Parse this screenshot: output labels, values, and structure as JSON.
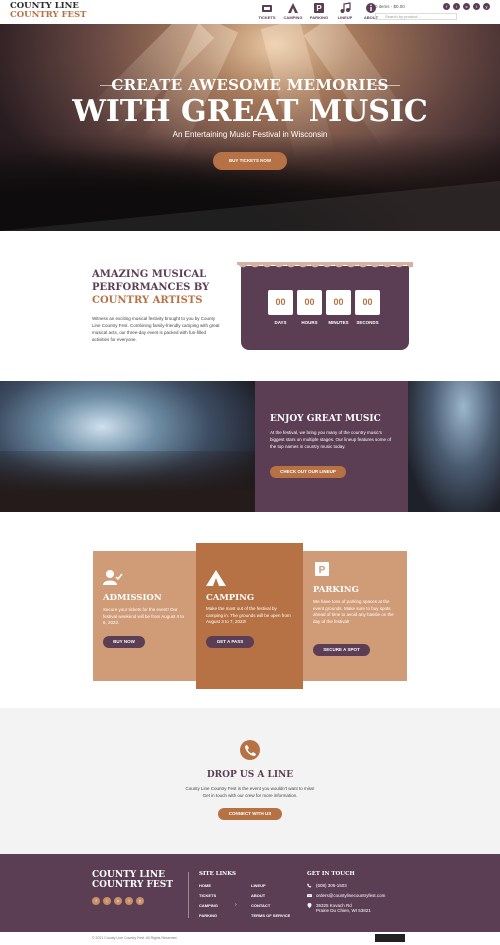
{
  "header": {
    "logo_line1": "COUNTY LINE",
    "logo_line2": "COUNTRY FEST",
    "nav": [
      {
        "label": "TICKETS",
        "icon": "ticket-icon"
      },
      {
        "label": "CAMPING",
        "icon": "tent-icon"
      },
      {
        "label": "PARKING",
        "icon": "parking-icon"
      },
      {
        "label": "LINEUP",
        "icon": "music-note-icon"
      },
      {
        "label": "ABOUT",
        "icon": "info-icon"
      }
    ],
    "cart": "0 items - $0.00",
    "search_placeholder": "Search by product...",
    "social": [
      "f",
      "i",
      "s",
      "t",
      "y"
    ]
  },
  "hero": {
    "line1": "CREATE AWESOME MEMORIES",
    "line2": "WITH GREAT MUSIC",
    "line3": "An Entertaining Music Festival in Wisconsin",
    "button": "BUY TICKETS NOW"
  },
  "amazing": {
    "title_line1": "AMAZING MUSICAL",
    "title_line2": "PERFORMANCES BY",
    "title_accent": "COUNTRY ARTISTS",
    "text": "Witness an exciting musical festivity brought to you by County Line Country Fest. Combining family-friendly camping with great musical acts, our three-day event is packed with fun-filled activities for everyone.",
    "countdown": [
      {
        "value": "00",
        "label": "DAYS"
      },
      {
        "value": "00",
        "label": "HOURS"
      },
      {
        "value": "00",
        "label": "MINUTES"
      },
      {
        "value": "00",
        "label": "SECONDS"
      }
    ]
  },
  "music": {
    "title": "ENJOY GREAT MUSIC",
    "text": "At the festival, we bring you many of the country music's biggest stars on multiple stages. Our lineup features some of the top names in country music today.",
    "button": "CHECK OUT OUR LINEUP"
  },
  "cards": [
    {
      "title": "ADMISSION",
      "text": "Secure your tickets for the event! Our festival weekend will be from August 4 to 6, 2022.",
      "button": "BUY NOW",
      "icon": "user-check-icon",
      "color": "#d09b77"
    },
    {
      "title": "CAMPING",
      "text": "Make the most out of the festival by camping in. The grounds will be open from August 3 to 7, 2022!",
      "button": "GET A PASS",
      "icon": "tent-icon",
      "color": "#b67244"
    },
    {
      "title": "PARKING",
      "text": "We have tons of parking spaces at the event grounds. Make sure to buy spots ahead of time to avoid any hassle on the day of the festival!",
      "button": "SECURE A SPOT",
      "icon": "parking-icon",
      "color": "#d09b77"
    }
  ],
  "contact": {
    "title": "DROP US A LINE",
    "text1": "County Line Country Fest is the event you wouldn't want to miss!",
    "text2": "Get in touch with our crew for more information.",
    "button": "CONNECT WITH US"
  },
  "footer": {
    "logo_line1": "COUNTY LINE",
    "logo_line2": "COUNTRY FEST",
    "site_links_title": "SITE LINKS",
    "links_col1": [
      "HOME",
      "TICKETS",
      "CAMPING",
      "PARKING"
    ],
    "links_col2": [
      "LINEUP",
      "ABOUT",
      "CONTACT",
      "TERMS OF SERVICE"
    ],
    "get_in_touch_title": "GET IN TOUCH",
    "phone": "(608) 306-1503",
    "email": "orders@countylinecountryfest.com",
    "address_line1": "35325 Kovach Rd",
    "address_line2": "Prairie Du Chien, WI 53821",
    "social": [
      "f",
      "i",
      "s",
      "t",
      "y"
    ]
  },
  "copyright": "© 2021 County Line Country Fest. All Rights Reserved."
}
